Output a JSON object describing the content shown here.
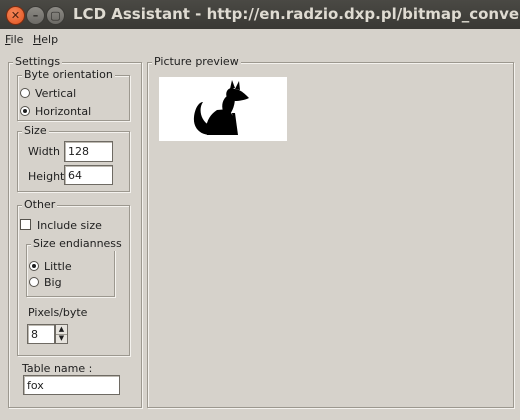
{
  "window": {
    "title": "LCD Assistant -  http://en.radzio.dxp.pl/bitmap_converter/",
    "close_glyph": "✕",
    "minimize_glyph": "–",
    "maximize_glyph": "▢"
  },
  "menu": {
    "file": {
      "mnemonic": "F",
      "rest": "ile"
    },
    "help": {
      "mnemonic": "H",
      "rest": "elp"
    }
  },
  "settings": {
    "label": "Settings",
    "byte_orientation": {
      "label": "Byte orientation",
      "options": [
        "Vertical",
        "Horizontal"
      ],
      "selected": "Horizontal"
    },
    "size": {
      "label": "Size",
      "width_label": "Width",
      "width_value": "128",
      "height_label": "Height",
      "height_value": "64"
    },
    "other": {
      "label": "Other",
      "include_size_label": "Include size",
      "include_size_checked": false,
      "endianness": {
        "label": "Size endianness",
        "options": [
          "Little",
          "Big"
        ],
        "selected": "Little"
      },
      "pixels_per_byte_label": "Pixels/byte",
      "pixels_per_byte_value": "8"
    },
    "table_name_label": "Table name :",
    "table_name_value": "fox"
  },
  "preview": {
    "label": "Picture preview",
    "image_subject": "fox-silhouette"
  }
}
